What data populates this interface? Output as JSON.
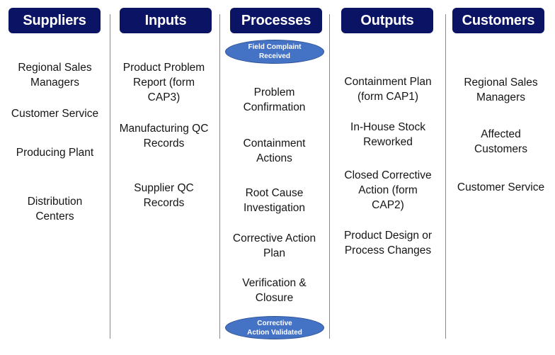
{
  "columns": [
    {
      "title": "Suppliers",
      "items": [
        "Regional Sales\nManagers",
        "Customer Service",
        "Producing Plant",
        "Distribution\nCenters"
      ]
    },
    {
      "title": "Inputs",
      "items": [
        "Product Problem\nReport (form\nCAP3)",
        "Manufacturing QC\nRecords",
        "Supplier QC\nRecords"
      ]
    },
    {
      "title": "Processes",
      "start_event": "Field Complaint\nReceived",
      "items": [
        "Problem\nConfirmation",
        "Containment\nActions",
        "Root Cause\nInvestigation",
        "Corrective Action\nPlan",
        "Verification &\nClosure"
      ],
      "end_event": "Corrective\nAction Validated"
    },
    {
      "title": "Outputs",
      "items": [
        "Containment Plan\n(form CAP1)",
        "In-House Stock\nReworked",
        "Closed Corrective\nAction (form\nCAP2)",
        "Product Design or\nProcess Changes"
      ]
    },
    {
      "title": "Customers",
      "items": [
        "Regional Sales\nManagers",
        "Affected\nCustomers",
        "Customer Service"
      ]
    }
  ],
  "colors": {
    "header_bg": "#0b1464",
    "header_text": "#ffffff",
    "event_fill": "#4472c4",
    "divider": "#8a8a8a"
  }
}
